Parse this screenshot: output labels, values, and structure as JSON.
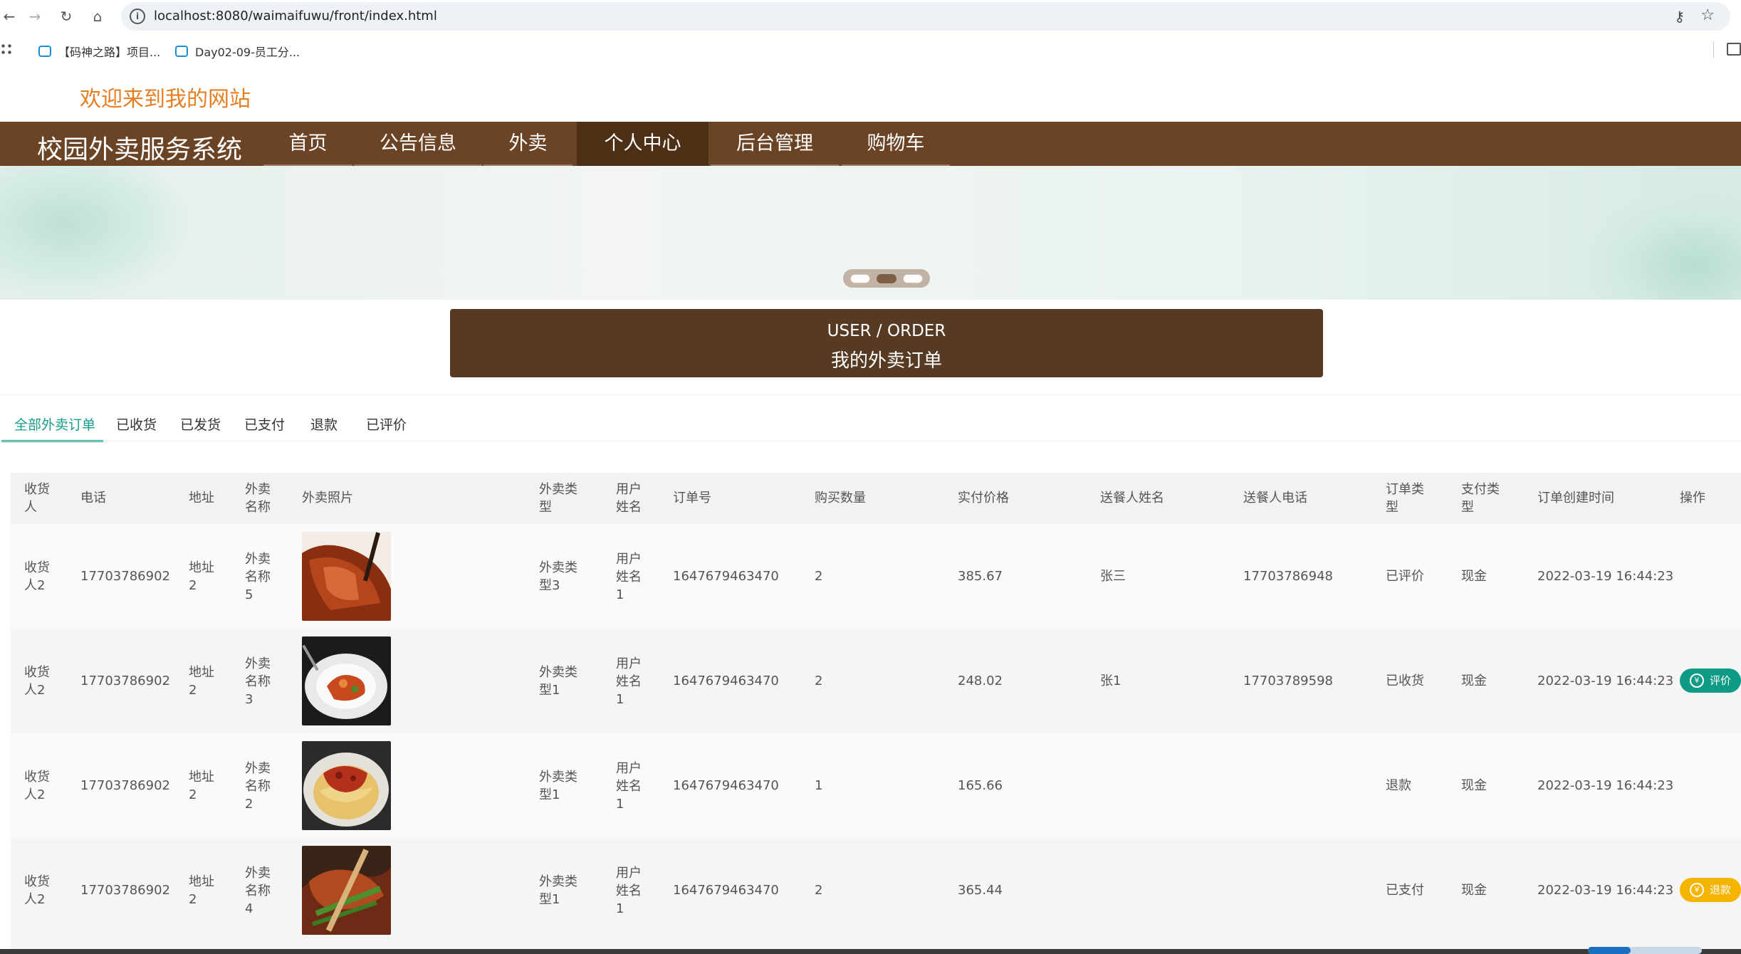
{
  "browser": {
    "url": "localhost:8080/waimaifuwu/front/index.html",
    "bookmarks": [
      "【码神之路】项目...",
      "Day02-09-员工分..."
    ]
  },
  "site": {
    "welcome": "欢迎来到我的网站",
    "brand": "校园外卖服务系统",
    "nav": [
      "首页",
      "公告信息",
      "外卖",
      "个人中心",
      "后台管理",
      "购物车"
    ],
    "nav_active": "个人中心"
  },
  "order_header": {
    "en": "USER / ORDER",
    "cn": "我的外卖订单"
  },
  "tabs": [
    "全部外卖订单",
    "已收货",
    "已发货",
    "已支付",
    "退款",
    "已评价"
  ],
  "tab_active": "全部外卖订单",
  "table": {
    "headers": [
      "收货人",
      "电话",
      "地址",
      "外卖名称",
      "外卖照片",
      "外卖类型",
      "用户姓名",
      "订单号",
      "购买数量",
      "实付价格",
      "送餐人姓名",
      "送餐人电话",
      "订单类型",
      "支付类型",
      "订单创建时间",
      "操作"
    ],
    "rows": [
      {
        "consignee": "收货人2",
        "phone": "17703786902",
        "address": "地址2",
        "food_name": "外卖名称5",
        "food_type": "外卖类型3",
        "user_name": "用户姓名1",
        "order_no": "1647679463470",
        "quantity": "2",
        "price": "385.67",
        "courier_name": "张三",
        "courier_phone": "17703786948",
        "order_status": "已评价",
        "pay_type": "现金",
        "created": "2022-03-19 16:44:23",
        "action": ""
      },
      {
        "consignee": "收货人2",
        "phone": "17703786902",
        "address": "地址2",
        "food_name": "外卖名称3",
        "food_type": "外卖类型1",
        "user_name": "用户姓名1",
        "order_no": "1647679463470",
        "quantity": "2",
        "price": "248.02",
        "courier_name": "张1",
        "courier_phone": "17703789598",
        "order_status": "已收货",
        "pay_type": "现金",
        "created": "2022-03-19 16:44:23",
        "action": "评价"
      },
      {
        "consignee": "收货人2",
        "phone": "17703786902",
        "address": "地址2",
        "food_name": "外卖名称2",
        "food_type": "外卖类型1",
        "user_name": "用户姓名1",
        "order_no": "1647679463470",
        "quantity": "1",
        "price": "165.66",
        "courier_name": "",
        "courier_phone": "",
        "order_status": "退款",
        "pay_type": "现金",
        "created": "2022-03-19 16:44:23",
        "action": ""
      },
      {
        "consignee": "收货人2",
        "phone": "17703786902",
        "address": "地址2",
        "food_name": "外卖名称4",
        "food_type": "外卖类型1",
        "user_name": "用户姓名1",
        "order_no": "1647679463470",
        "quantity": "2",
        "price": "365.44",
        "courier_name": "",
        "courier_phone": "",
        "order_status": "已支付",
        "pay_type": "现金",
        "created": "2022-03-19 16:44:23",
        "action": "退款"
      }
    ]
  },
  "colors": {
    "brand_brown": "#6b4426",
    "accent_teal": "#159c8a",
    "welcome_orange": "#e67e22",
    "refund_yellow": "#f5b400",
    "review_teal": "#0f9a85"
  }
}
